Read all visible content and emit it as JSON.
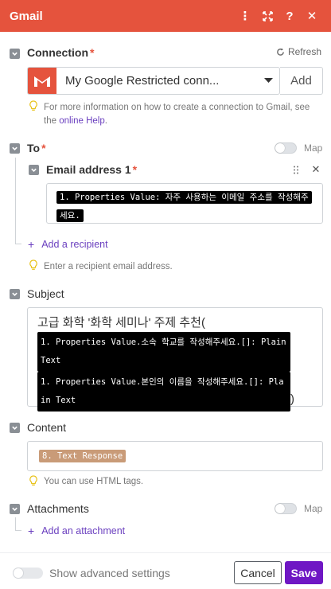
{
  "header": {
    "title": "Gmail"
  },
  "connection": {
    "label": "Connection",
    "required_mark": "*",
    "refresh_label": "Refresh",
    "selected": "My Google Restricted conn...",
    "add_label": "Add",
    "hint_text": "For more information on how to create a connection to Gmail, see the",
    "hint_link": "online Help",
    "hint_end": "."
  },
  "to": {
    "label": "To",
    "required_mark": "*",
    "map_label": "Map",
    "item": {
      "label": "Email address 1",
      "required_mark": "*",
      "value_pill": "1. Properties Value: 자주 사용하는 이메일 주소를 작성해주세요."
    },
    "add_recipient_label": "Add a recipient",
    "hint": "Enter a recipient email address."
  },
  "subject": {
    "label": "Subject",
    "prefix_text": "고급 화학 '화학 세미나' 주제 추천(",
    "pill1": "1. Properties Value.소속 학교를 작성해주세요.[]: Plain Text",
    "pill2": "1. Properties Value.본인의 이름을 작성해주세요.[]: Plain Text",
    "suffix_text": ")"
  },
  "content": {
    "label": "Content",
    "value_pill": "8. Text Response",
    "hint": "You can use HTML tags."
  },
  "attachments": {
    "label": "Attachments",
    "map_label": "Map",
    "add_label": "Add an attachment"
  },
  "footer": {
    "advanced_label": "Show advanced settings",
    "cancel_label": "Cancel",
    "save_label": "Save"
  },
  "colors": {
    "brand": "#e5533d",
    "accent": "#6f17c4",
    "link": "#6a3fbf"
  }
}
